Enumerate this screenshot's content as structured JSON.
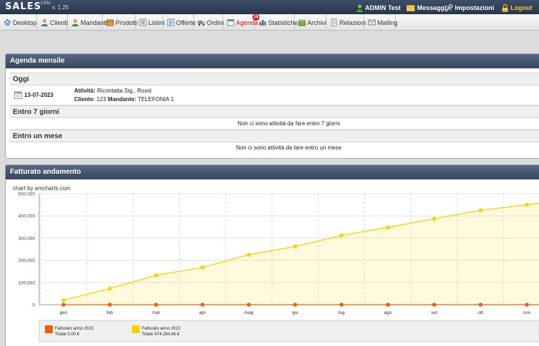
{
  "app": {
    "logo": "SALES",
    "logo_sup": "CRM",
    "version": "v. 1.25",
    "user_label": "ADMIN Test",
    "messages_label": "Messaggi",
    "settings_label": "Impostazioni",
    "logout_label": "Logout"
  },
  "nav": {
    "items": [
      {
        "label": "Desktop",
        "icon": "house-icon"
      },
      {
        "label": "Clienti",
        "icon": "person-icon"
      },
      {
        "label": "Mandanti",
        "icon": "person-icon"
      },
      {
        "label": "Prodotti",
        "icon": "box-icon"
      },
      {
        "label": "Listini",
        "icon": "list-icon"
      },
      {
        "label": "Offerte",
        "icon": "offer-icon"
      },
      {
        "label": "Ordini",
        "icon": "truck-icon"
      },
      {
        "label": "Agenda",
        "icon": "calendar-icon",
        "badge": "18"
      },
      {
        "label": "Statistiche",
        "icon": "chart-icon"
      },
      {
        "label": "Archivi",
        "icon": "archive-icon"
      },
      {
        "label": "Relazioni",
        "icon": "document-icon"
      },
      {
        "label": "Mailing",
        "icon": "mail-icon"
      }
    ],
    "active": "Agenda"
  },
  "agenda": {
    "title": "Agenda mensile",
    "today_label": "Oggi",
    "event": {
      "date": "13-07-2023",
      "activity_label": "Attività:",
      "activity_value": "Ricontatta Sig,. Rossi",
      "client_label": "Cliente:",
      "client_value": "123",
      "mandante_label": "Mandante:",
      "mandante_value": "TELEFONIA 1"
    },
    "week_label": "Entro 7 giorni",
    "week_empty": "Non ci sono attività da fare entro 7 giorni",
    "month_label": "Entro un mese",
    "month_empty": "Non ci sono attività da fare entro un mese"
  },
  "fatturato": {
    "title": "Fatturato andamento",
    "credit": "chart by amcharts.com"
  },
  "colors": {
    "series_2023": "#f06000",
    "series_2022": "#ffd000",
    "header": "#3a4a61"
  },
  "chart_data": {
    "type": "area",
    "categories": [
      "gen",
      "feb",
      "mar",
      "apr",
      "mag",
      "giu",
      "lug",
      "ago",
      "set",
      "ott",
      "nov"
    ],
    "ylim": [
      0,
      500000
    ],
    "yticks": [
      "0",
      "100,000",
      "200,000",
      "300,000",
      "400,000",
      "500,000"
    ],
    "grid": true,
    "legend_position": "bottom",
    "series": [
      {
        "name": "Fatturato anno 2023",
        "total": "Totale 0,00 €",
        "values": [
          0,
          0,
          0,
          0,
          0,
          0,
          0,
          0,
          0,
          0,
          0
        ]
      },
      {
        "name": "Fatturato anno 2022",
        "total": "Totale 474.284,46 €",
        "values": [
          20000,
          73000,
          132000,
          168000,
          225000,
          262000,
          312000,
          348000,
          387000,
          425000,
          450000
        ]
      }
    ]
  }
}
